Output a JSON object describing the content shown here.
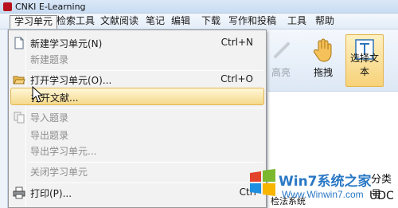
{
  "window": {
    "title": "CNKI E-Learning"
  },
  "menubar": {
    "items": [
      {
        "label": "学习单元",
        "active": true
      },
      {
        "label": "检索工具"
      },
      {
        "label": "文献阅读"
      },
      {
        "label": "笔记"
      },
      {
        "label": "编辑"
      },
      {
        "label": "下载"
      },
      {
        "label": "写作和投稿"
      },
      {
        "label": "工具"
      },
      {
        "label": "帮助"
      }
    ]
  },
  "file_menu": {
    "items": [
      {
        "label": "新建学习单元(N)",
        "shortcut": "Ctrl+N",
        "icon": "new-document-icon"
      },
      {
        "label": "新建题录",
        "disabled": true
      },
      {
        "label": "打开学习单元(O)...",
        "shortcut": "Ctrl+O",
        "icon": "open-folder-icon"
      },
      {
        "label": "打开文献...",
        "hover": true
      },
      {
        "label": "导入题录",
        "disabled": true,
        "icon": "import-icon"
      },
      {
        "label": "导出题录",
        "disabled": true
      },
      {
        "label": "导出学习单元...",
        "disabled": true
      },
      {
        "label": "关闭学习单元",
        "disabled": true
      },
      {
        "label": "打印(P)...",
        "shortcut": "Ctrl",
        "icon": "printer-icon"
      }
    ]
  },
  "toolbar": {
    "highlight_label": "高亮",
    "drag_label": "拖拽",
    "select_text_label": "选择文本"
  },
  "document": {
    "fragment_1": "分类号",
    "fragment_2": "UDC",
    "fragment_3": "检法系统"
  },
  "watermark": {
    "main": "Win7系统之家",
    "url": "Www.Winwin7.com"
  },
  "colors": {
    "menu_hover": "#f5d98a",
    "selected_tool": "#f7d27a",
    "watermark": "#2a78c5"
  }
}
